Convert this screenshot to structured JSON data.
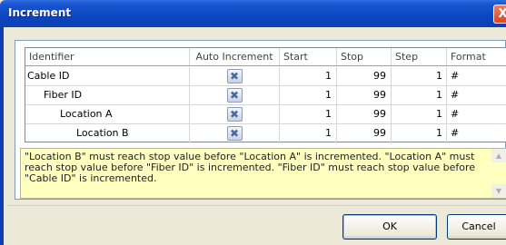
{
  "window": {
    "title": "Increment",
    "close_glyph": "X"
  },
  "table": {
    "headers": {
      "identifier": "Identifier",
      "auto_increment": "Auto Increment",
      "start": "Start",
      "stop": "Stop",
      "step": "Step",
      "format": "Format"
    },
    "rows": [
      {
        "identifier": "Cable ID",
        "auto_increment": "✖",
        "start": "1",
        "stop": "99",
        "step": "1",
        "format": "#"
      },
      {
        "identifier": "Fiber ID",
        "auto_increment": "✖",
        "start": "1",
        "stop": "99",
        "step": "1",
        "format": "#"
      },
      {
        "identifier": "Location A",
        "auto_increment": "✖",
        "start": "1",
        "stop": "99",
        "step": "1",
        "format": "#"
      },
      {
        "identifier": "Location B",
        "auto_increment": "✖",
        "start": "1",
        "stop": "99",
        "step": "1",
        "format": "#"
      }
    ]
  },
  "description": "\"Location B\" must reach stop value before \"Location A\" is incremented. \"Location A\" must reach stop value before \"Fiber ID\" is incremented. \"Fiber ID\" must reach stop value before \"Cable ID\" is incremented.",
  "buttons": {
    "ok": "OK",
    "cancel": "Cancel"
  },
  "icons": {
    "auto_increment_toggle": "x-icon",
    "close": "close-icon",
    "scroll_up": "chevron-up-icon",
    "scroll_down": "chevron-down-icon"
  }
}
